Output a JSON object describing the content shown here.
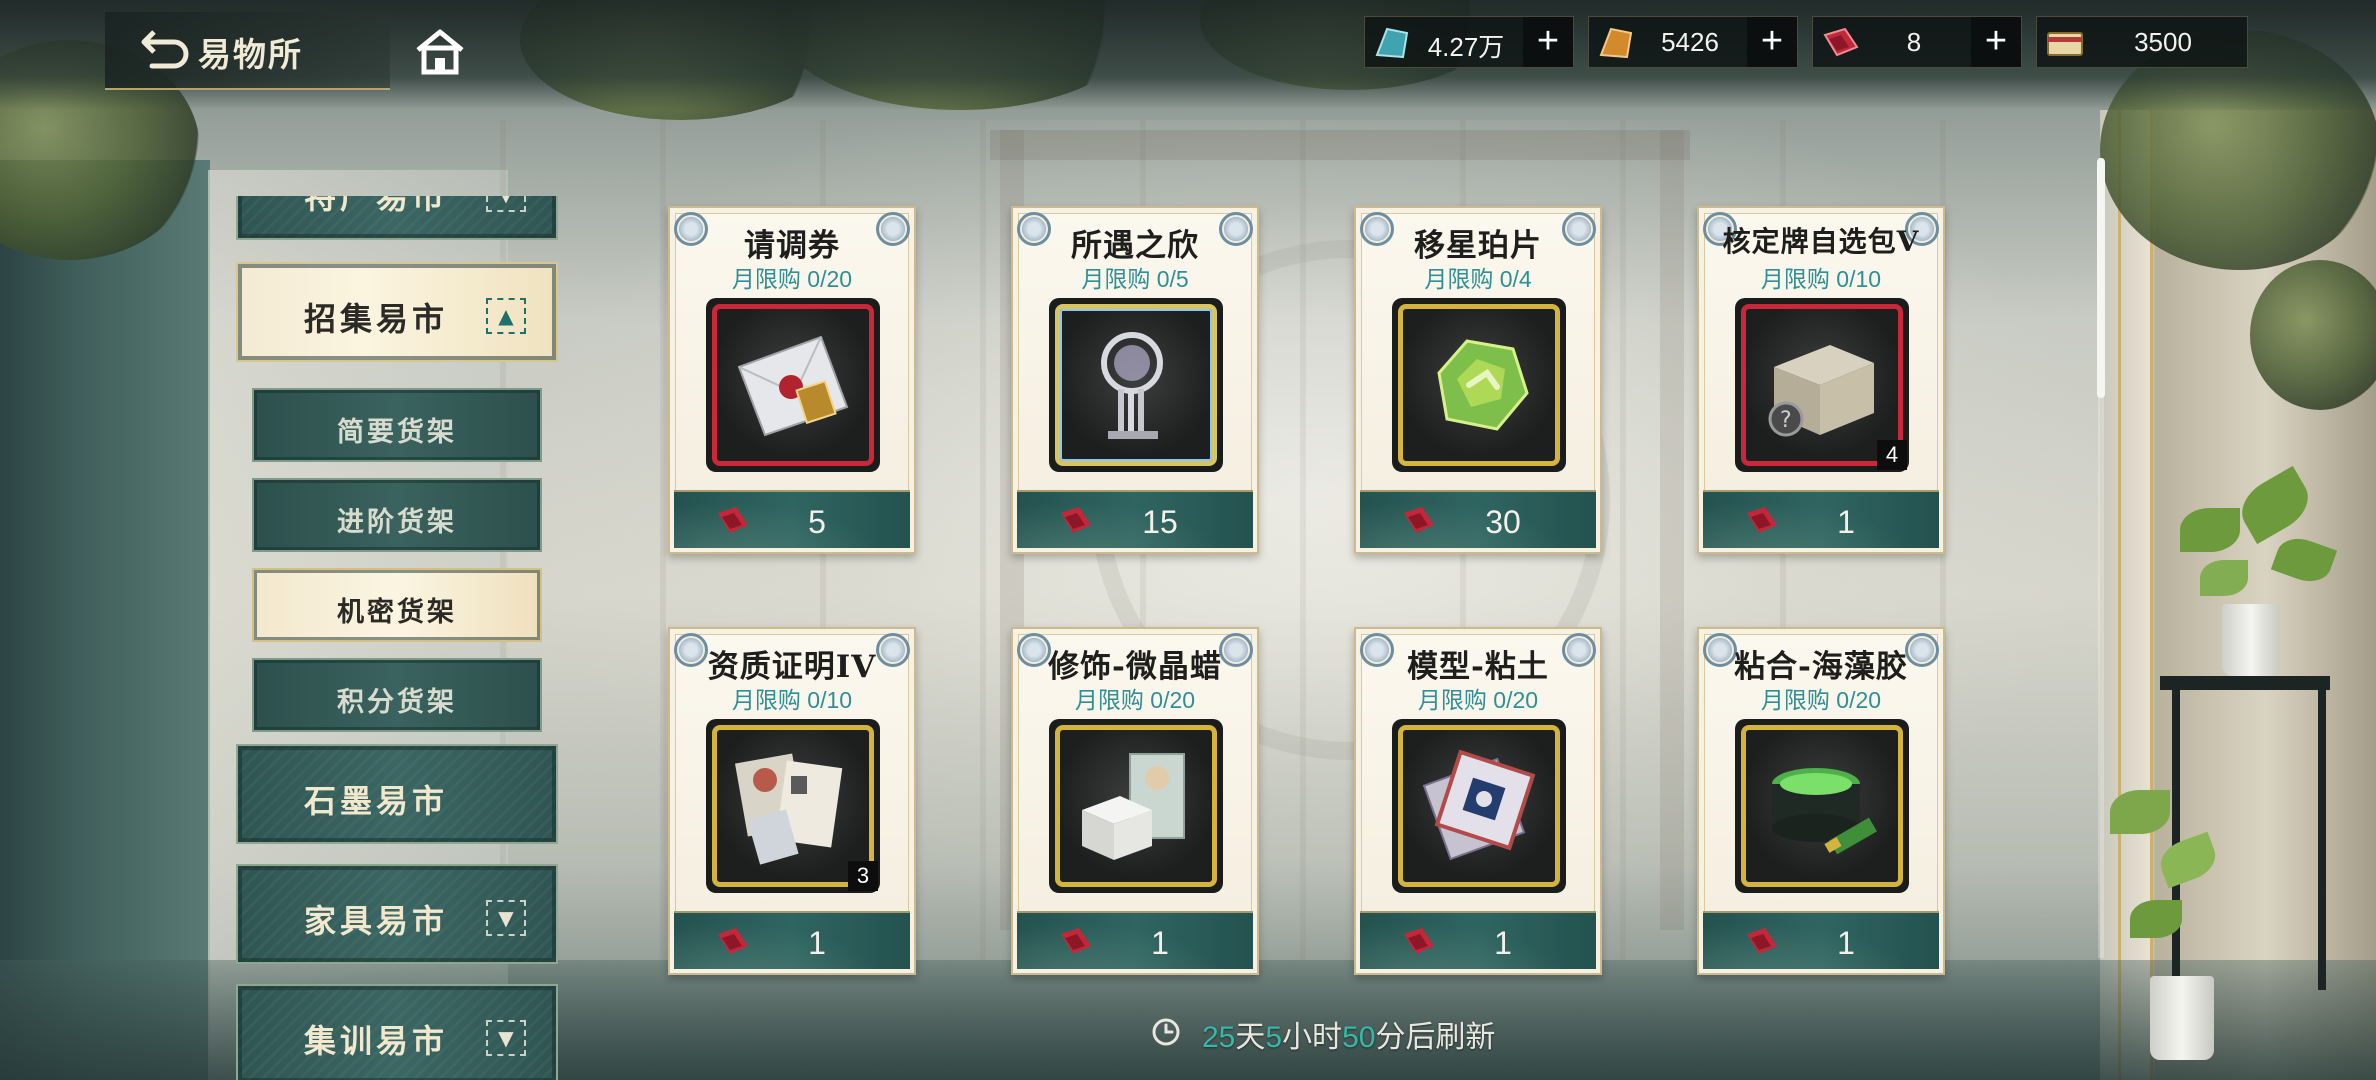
{
  "header": {
    "title": "易物所"
  },
  "currencies": [
    {
      "icon": "teal-crystal-icon",
      "value": "4.27万",
      "color": "#3fa3b0"
    },
    {
      "icon": "orange-crystal-icon",
      "value": "5426",
      "color": "#d28a2c"
    },
    {
      "icon": "red-ticket-icon",
      "value": "8",
      "color": "#c2283a"
    },
    {
      "icon": "point-card-icon",
      "value": "3500",
      "color": "#c9a04a"
    }
  ],
  "menu": {
    "partial_top": "特产易市",
    "recruit": {
      "label": "招集易市",
      "active": true
    },
    "subs": [
      {
        "label": "简要货架",
        "active": false
      },
      {
        "label": "进阶货架",
        "active": false
      },
      {
        "label": "机密货架",
        "active": true
      },
      {
        "label": "积分货架",
        "active": false
      }
    ],
    "ink": {
      "label": "石墨易市"
    },
    "furniture": {
      "label": "家具易市"
    },
    "training": {
      "label": "集训易市"
    }
  },
  "products": [
    {
      "name": "请调券",
      "limit": "月限购 0/20",
      "price": "5",
      "qty": "",
      "icon": "envelope-icon",
      "frame": "red"
    },
    {
      "name": "所遇之欣",
      "limit": "月限购 0/5",
      "price": "15",
      "qty": "",
      "icon": "trophy-icon",
      "frame": "rainbow"
    },
    {
      "name": "移星珀片",
      "limit": "月限购 0/4",
      "price": "30",
      "qty": "",
      "icon": "amber-gem-icon",
      "frame": "gold"
    },
    {
      "name": "核定牌自选包V",
      "limit": "月限购 0/10",
      "price": "1",
      "qty": "4",
      "icon": "mystery-box-icon",
      "frame": "red"
    },
    {
      "name": "资质证明IV",
      "limit": "月限购 0/10",
      "price": "1",
      "qty": "3",
      "icon": "documents-icon",
      "frame": "gold"
    },
    {
      "name": "修饰-微晶蜡",
      "limit": "月限购 0/20",
      "price": "1",
      "qty": "",
      "icon": "wax-box-icon",
      "frame": "gold"
    },
    {
      "name": "模型-粘土",
      "limit": "月限购 0/20",
      "price": "1",
      "qty": "",
      "icon": "clay-pack-icon",
      "frame": "gold"
    },
    {
      "name": "粘合-海藻胶",
      "limit": "月限购 0/20",
      "price": "1",
      "qty": "",
      "icon": "glue-jar-icon",
      "frame": "gold"
    }
  ],
  "refresh": {
    "days": "25",
    "days_unit": "天",
    "hours": "5",
    "hours_unit": "小时",
    "minutes": "50",
    "suffix": "分后刷新"
  }
}
